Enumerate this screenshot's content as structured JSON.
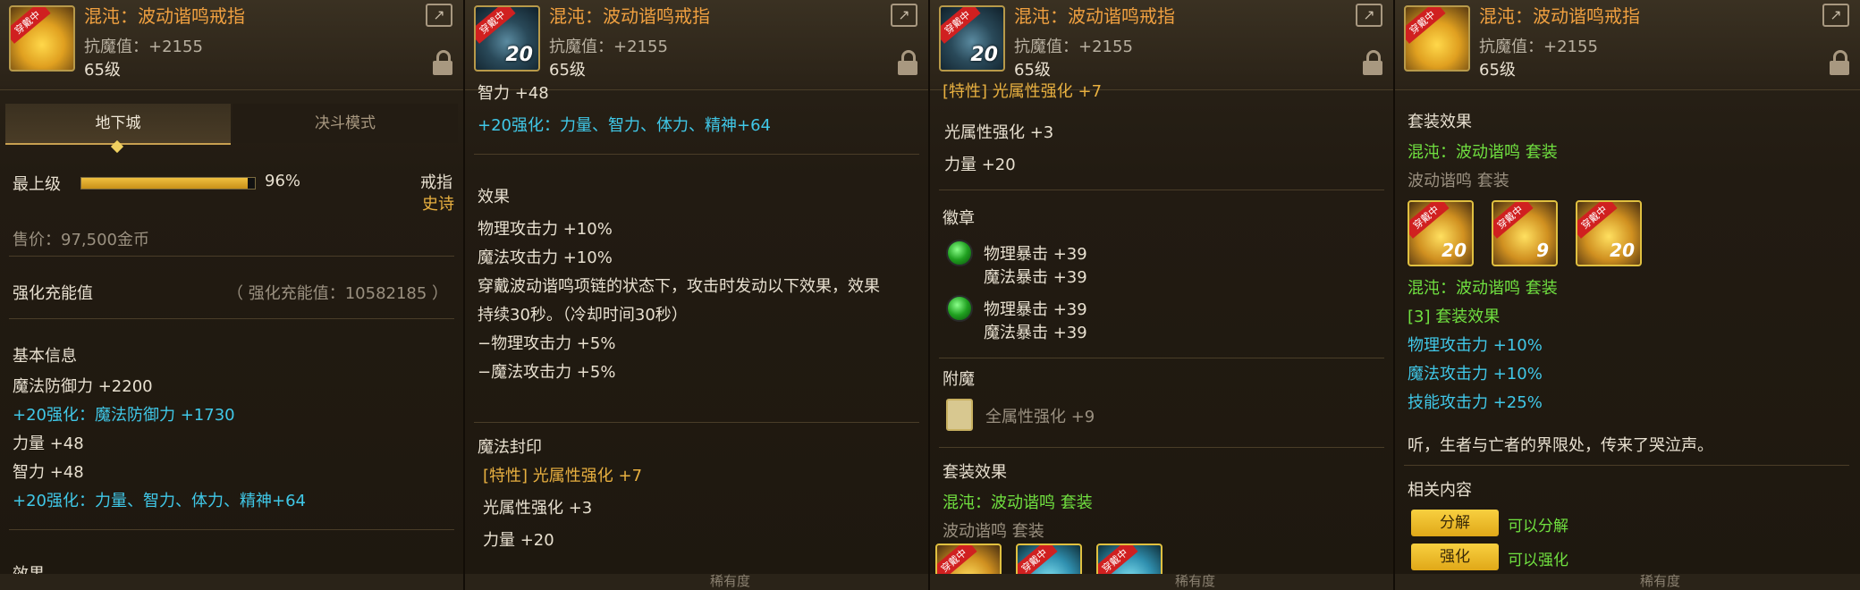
{
  "colors": {
    "name": "#f0a040",
    "enhance": "#40c8e8",
    "set": "#70e040",
    "gold": "#e8b040"
  },
  "item": {
    "name": "混沌：波动谐鸣戒指",
    "stat": "抗魔值：+2155",
    "level": "65级",
    "badge": "穿戴中",
    "enhance_level": "20"
  },
  "icons": {
    "share": "share-icon",
    "lock": "lock-icon",
    "gem": "green-emblem-icon",
    "enchant": "card-icon"
  },
  "footer": {
    "label": "稀有度"
  },
  "panel1": {
    "tabs": [
      "地下城",
      "决斗模式"
    ],
    "grade_label": "最上级",
    "grade_percent": "96%",
    "grade_fill": 0.96,
    "item_type": "戒指",
    "rarity": "史诗",
    "price": "售价：97,500金币",
    "charge_label": "强化充能值",
    "charge_value": "（ 强化充能值：10582185 ）",
    "basic_header": "基本信息",
    "lines": [
      "魔法防御力 +2200",
      "+20强化：魔法防御力 +1730",
      "力量 +48",
      "智力 +48",
      "+20强化：力量、智力、体力、精神+64"
    ],
    "effect_header": "效果"
  },
  "panel2": {
    "partial_top": "智力 +48",
    "enhance_line": "+20强化：力量、智力、体力、精神+64",
    "effect_header": "效果",
    "effects": [
      "物理攻击力 +10%",
      "魔法攻击力 +10%",
      "穿戴波动谐鸣项链的状态下，攻击时发动以下效果，效果",
      "持续30秒。（冷却时间30秒）",
      "−物理攻击力 +5%",
      "−魔法攻击力 +5%"
    ],
    "seal_header": "魔法封印",
    "seal_trait": "[特性] 光属性强化 +7",
    "seal_lines": [
      "光属性强化 +3",
      "力量 +20"
    ]
  },
  "panel3": {
    "partial_top": "[特性] 光属性强化 +7",
    "lines": [
      "光属性强化 +3",
      "力量 +20"
    ],
    "emblem_header": "徽章",
    "emblems": [
      [
        "物理暴击 +39",
        "魔法暴击 +39"
      ],
      [
        "物理暴击 +39",
        "魔法暴击 +39"
      ]
    ],
    "enchant_header": "附魔",
    "enchant_value": "全属性强化 +9",
    "set_header": "套装效果",
    "set_name": "混沌：波动谐鸣 套装",
    "set_sub": "波动谐鸣 套装"
  },
  "panel4": {
    "set_header": "套装效果",
    "set_name": "混沌：波动谐鸣 套装",
    "set_sub": "波动谐鸣 套装",
    "set_icons": [
      {
        "level": "20"
      },
      {
        "level": "9"
      },
      {
        "level": "20"
      }
    ],
    "set_name2": "混沌：波动谐鸣 套装",
    "set_bonus_label": "[3] 套装效果",
    "bonuses": [
      "物理攻击力 +10%",
      "魔法攻击力 +10%",
      "技能攻击力 +25%"
    ],
    "flavor": "听，生者与亡者的界限处，传来了哭泣声。",
    "related_header": "相关内容",
    "actions": [
      {
        "button": "分解",
        "text": "可以分解"
      },
      {
        "button": "强化",
        "text": "可以强化"
      }
    ]
  }
}
